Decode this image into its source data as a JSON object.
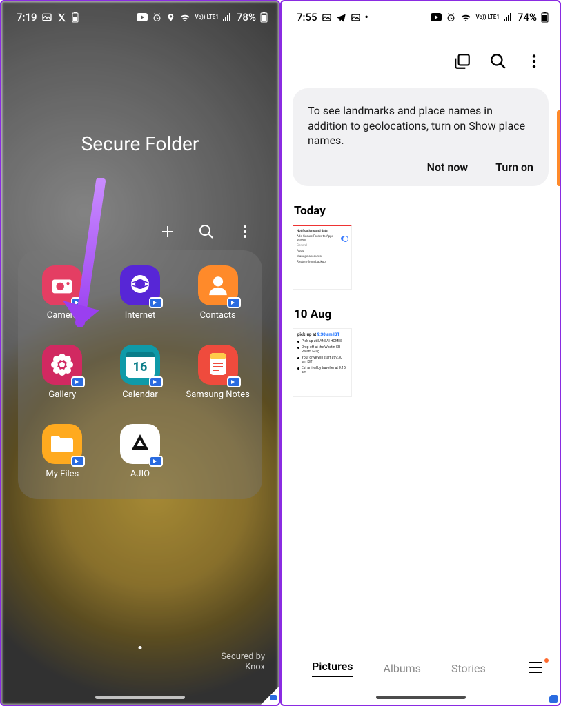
{
  "left": {
    "status": {
      "time": "7:19",
      "battery": "78%",
      "net_label": "Vo)) LTE1"
    },
    "title": "Secure Folder",
    "apps": [
      {
        "name": "Camera"
      },
      {
        "name": "Internet"
      },
      {
        "name": "Contacts"
      },
      {
        "name": "Gallery"
      },
      {
        "name": "Calendar"
      },
      {
        "name": "Samsung Notes"
      },
      {
        "name": "My Files"
      },
      {
        "name": "AJIO"
      }
    ],
    "calendar_day": "16",
    "secured_by": "Secured by\nKnox"
  },
  "right": {
    "status": {
      "time": "7:55",
      "battery": "74%",
      "net_label": "Vo)) LTE1"
    },
    "tip": {
      "text": "To see landmarks and place names in addition to geolocations, turn on Show place names.",
      "not_now": "Not now",
      "turn_on": "Turn on"
    },
    "sections": {
      "today": "Today",
      "aug10": "10 Aug"
    },
    "thumb_settings": {
      "h1": "Notifications and data",
      "row1": "Add Secure Folder to Apps screen",
      "h2": "General",
      "r2": "Apps",
      "r3": "Manage accounts",
      "r4": "Restore from backup"
    },
    "thumb_pickup": {
      "head_a": "pick-up at ",
      "head_b": "9:30 am IST",
      "r1": "Pick-up at SANSAI HOMES",
      "r2": "Drop off at the Westin CR Palam Gurg",
      "r3": "Your drive will start at 9:30 am IST",
      "r4": "Est arrival by traveller at 9:15 am"
    },
    "tabs": {
      "pictures": "Pictures",
      "albums": "Albums",
      "stories": "Stories"
    }
  }
}
